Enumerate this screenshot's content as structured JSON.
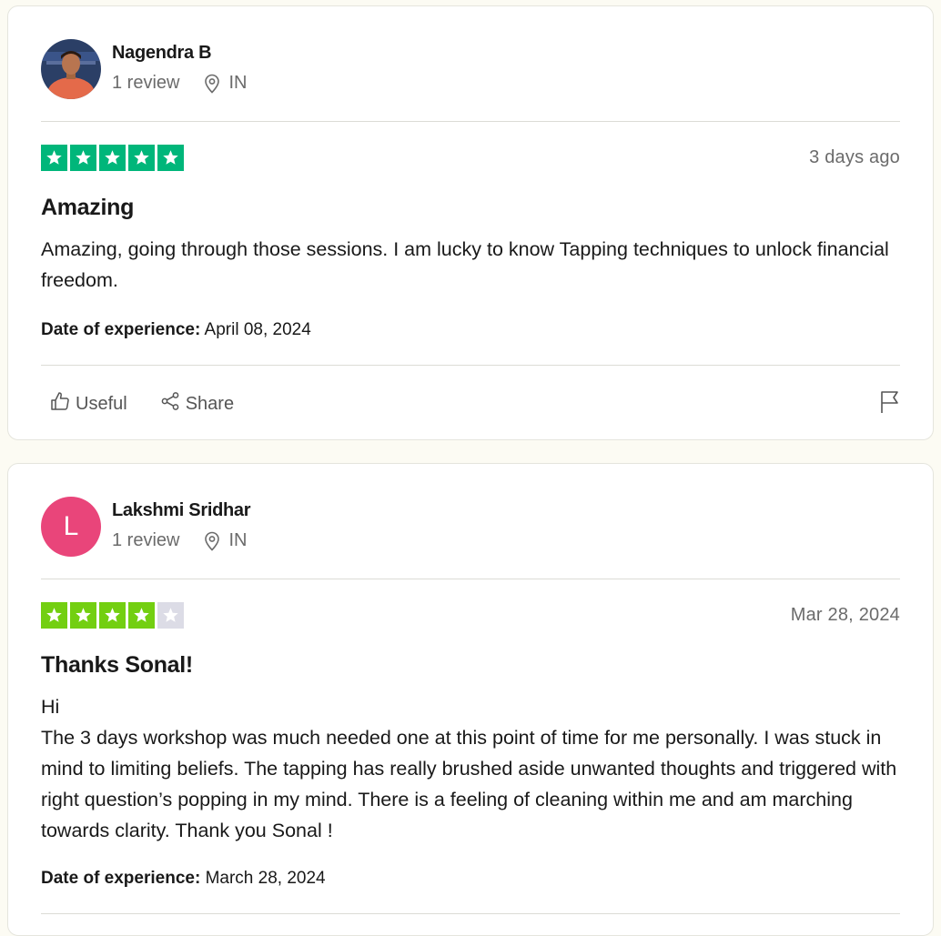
{
  "reviews": [
    {
      "reviewer": {
        "name": "Nagendra B",
        "review_count": "1 review",
        "country": "IN",
        "avatar": "photo"
      },
      "rating": 5,
      "star_color": "#00b67a",
      "date": "3 days ago",
      "title": "Amazing",
      "body": [
        "Amazing, going through those sessions. I am lucky to know Tapping techniques to unlock financial freedom."
      ],
      "experience_label": "Date of experience:",
      "experience_date": "April 08, 2024",
      "actions": {
        "useful": "Useful",
        "share": "Share"
      }
    },
    {
      "reviewer": {
        "name": "Lakshmi Sridhar",
        "review_count": "1 review",
        "country": "IN",
        "avatar": "L",
        "avatar_color": "#e9457a"
      },
      "rating": 4,
      "star_color": "#73cf11",
      "date": "Mar 28, 2024",
      "title": "Thanks Sonal!",
      "body": [
        "Hi",
        "The 3 days workshop was much needed one at this point of time for me personally. I was stuck in mind to limiting beliefs. The tapping has really brushed aside unwanted thoughts and triggered with right question’s popping in my mind. There is a feeling of cleaning within me and am marching towards clarity. Thank you Sonal !"
      ],
      "experience_label": "Date of experience:",
      "experience_date": "March 28, 2024"
    }
  ],
  "icons": {
    "location": "location-pin-icon",
    "useful": "thumbs-up-icon",
    "share": "share-icon",
    "report": "flag-icon",
    "star": "star-icon"
  },
  "colors": {
    "empty_star": "#dcdce6",
    "avatar_photo_bg": "#2b3f66"
  }
}
